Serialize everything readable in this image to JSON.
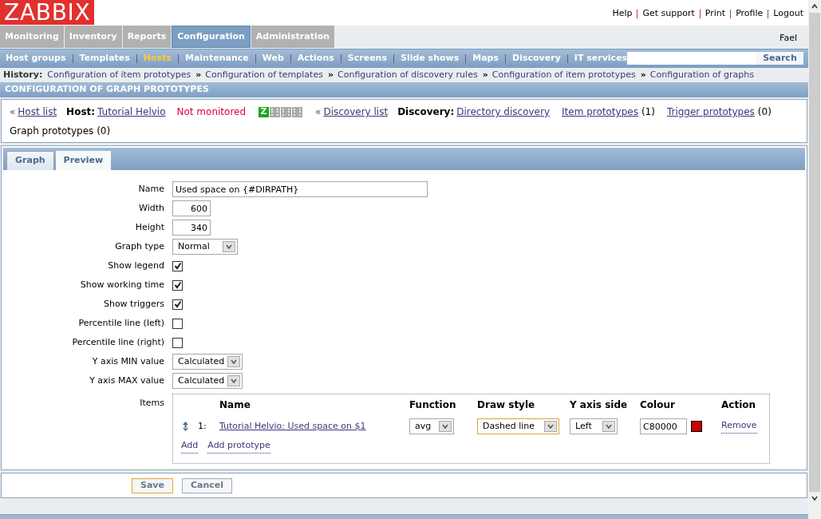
{
  "logo": "ZABBIX",
  "top_links": [
    "Help",
    "Get support",
    "Print",
    "Profile",
    "Logout"
  ],
  "user": "Fael",
  "main_menu": [
    {
      "label": "Monitoring",
      "selected": false
    },
    {
      "label": "Inventory",
      "selected": false
    },
    {
      "label": "Reports",
      "selected": false
    },
    {
      "label": "Configuration",
      "selected": true
    },
    {
      "label": "Administration",
      "selected": false
    }
  ],
  "sub_menu": [
    {
      "label": "Host groups",
      "selected": false
    },
    {
      "label": "Templates",
      "selected": false
    },
    {
      "label": "Hosts",
      "selected": true
    },
    {
      "label": "Maintenance",
      "selected": false
    },
    {
      "label": "Web",
      "selected": false
    },
    {
      "label": "Actions",
      "selected": false
    },
    {
      "label": "Screens",
      "selected": false
    },
    {
      "label": "Slide shows",
      "selected": false
    },
    {
      "label": "Maps",
      "selected": false
    },
    {
      "label": "Discovery",
      "selected": false
    },
    {
      "label": "IT services",
      "selected": false
    }
  ],
  "search_button": "Search",
  "history": {
    "label": "History:",
    "links": [
      "Configuration of item prototypes",
      "Configuration of templates",
      "Configuration of discovery rules",
      "Configuration of item prototypes",
      "Configuration of graphs"
    ],
    "separator": "»"
  },
  "page_title": "CONFIGURATION OF GRAPH PROTOTYPES",
  "host_info": {
    "back_mark": "«",
    "host_list": "Host list",
    "host_label": "Host:",
    "host": "Tutorial Helvio",
    "status": "Not monitored",
    "availability": [
      {
        "label": "Z",
        "available": true
      },
      {
        "available": false
      },
      {
        "available": false
      },
      {
        "available": false
      }
    ],
    "discovery_list": "Discovery list",
    "discovery_label": "Discovery:",
    "discovery": "Directory discovery",
    "counts": [
      {
        "link": "Item prototypes",
        "count": "(1)"
      },
      {
        "link": "Trigger prototypes",
        "count": "(0)"
      }
    ],
    "graph_prototypes": "Graph prototypes (0)"
  },
  "tabs": [
    {
      "label": "Graph",
      "selected": true
    },
    {
      "label": "Preview",
      "selected": false
    }
  ],
  "fields": [
    {
      "kind": "text",
      "label": "Name",
      "value": "Used space on {#DIRPATH}"
    },
    {
      "kind": "number",
      "label": "Width",
      "value": "600"
    },
    {
      "kind": "number",
      "label": "Height",
      "value": "340"
    },
    {
      "kind": "select",
      "label": "Graph type",
      "value": "Normal"
    },
    {
      "kind": "checkbox",
      "label": "Show legend",
      "checked": true
    },
    {
      "kind": "checkbox",
      "label": "Show working time",
      "checked": true
    },
    {
      "kind": "checkbox",
      "label": "Show triggers",
      "checked": true
    },
    {
      "kind": "checkbox",
      "label": "Percentile line (left)",
      "checked": false
    },
    {
      "kind": "checkbox",
      "label": "Percentile line (right)",
      "checked": false
    },
    {
      "kind": "select",
      "label": "Y axis MIN value",
      "value": "Calculated"
    },
    {
      "kind": "select",
      "label": "Y axis MAX value",
      "value": "Calculated"
    }
  ],
  "items": {
    "label": "Items",
    "columns": [
      "Name",
      "Function",
      "Draw style",
      "Y axis side",
      "Colour",
      "Action"
    ],
    "rows": [
      {
        "number": "1:",
        "name": "Tutorial Helvio: Used space on $1",
        "function": "avg",
        "draw_style": "Dashed line",
        "y_axis_side": "Left",
        "colour": "C80000",
        "color": "#c80000",
        "action": "Remove"
      }
    ],
    "links": [
      "Add",
      "Add prototype"
    ]
  },
  "buttons": [
    {
      "label": "Save",
      "selected": true
    },
    {
      "label": "Cancel",
      "selected": false
    }
  ]
}
